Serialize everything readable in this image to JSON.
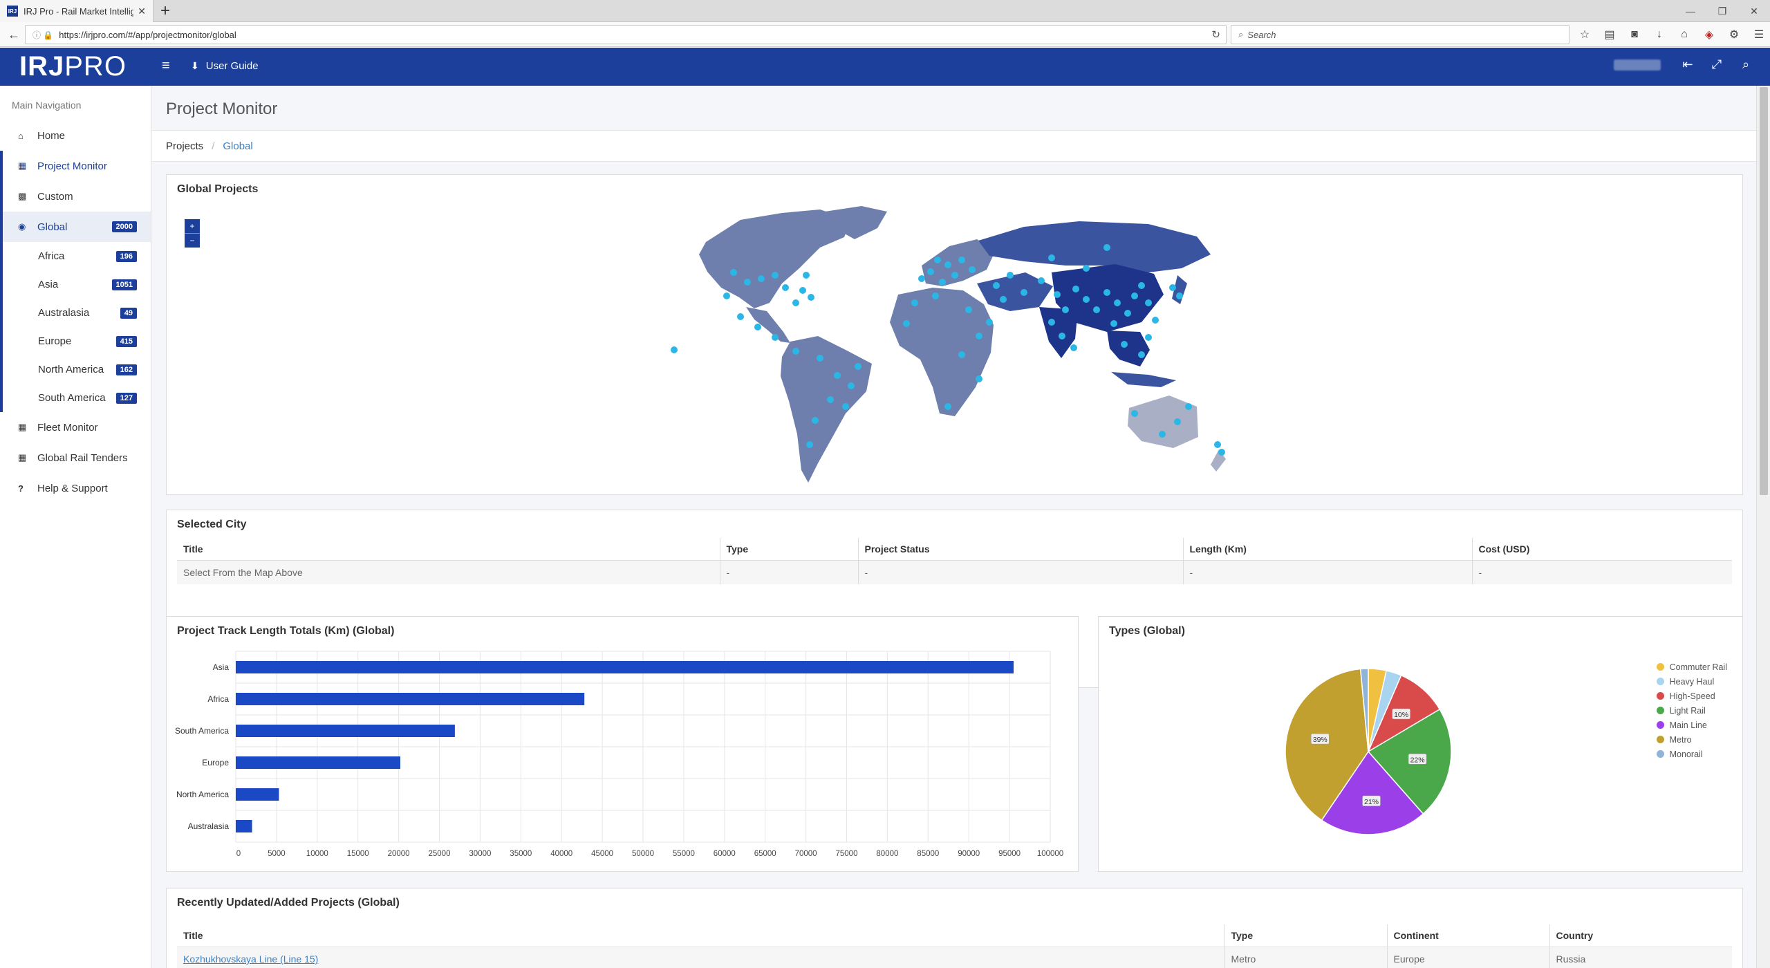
{
  "browser": {
    "tab_title": "IRJ Pro - Rail Market Intellig",
    "tab_favicon": "IRJ",
    "url": "https://irjpro.com/#/app/projectmonitor/global",
    "search_placeholder": "Search"
  },
  "header": {
    "logo_bold": "IRJ",
    "logo_light": "PRO",
    "user_guide": "User Guide",
    "color": "#1b3f9a"
  },
  "sidebar": {
    "heading": "Main Navigation",
    "home": "Home",
    "project_monitor": "Project Monitor",
    "custom": "Custom",
    "global": {
      "label": "Global",
      "count": "2000"
    },
    "regions": [
      {
        "label": "Africa",
        "count": "196"
      },
      {
        "label": "Asia",
        "count": "1051"
      },
      {
        "label": "Australasia",
        "count": "49"
      },
      {
        "label": "Europe",
        "count": "415"
      },
      {
        "label": "North America",
        "count": "162"
      },
      {
        "label": "South America",
        "count": "127"
      }
    ],
    "fleet_monitor": "Fleet Monitor",
    "tenders": "Global Rail Tenders",
    "help": "Help & Support"
  },
  "main": {
    "page_title": "Project Monitor",
    "breadcrumb": [
      "Projects",
      "Global"
    ],
    "map_title": "Global Projects",
    "zoom_in": "+",
    "zoom_out": "−",
    "selected_city": {
      "title": "Selected City",
      "columns": [
        "Title",
        "Type",
        "Project Status",
        "Length (Km)",
        "Cost (USD)"
      ],
      "row": [
        "Select From the Map Above",
        "-",
        "-",
        "-",
        "-"
      ]
    },
    "track_title": "Project Track Length Totals (Km) (Global)",
    "types_title": "Types (Global)",
    "recent": {
      "title": "Recently Updated/Added Projects (Global)",
      "columns": [
        "Title",
        "Type",
        "Continent",
        "Country"
      ],
      "row": [
        "Kozhukhovskaya Line (Line 15)",
        "Metro",
        "Europe",
        "Russia"
      ]
    }
  },
  "chart_data": [
    {
      "type": "bar",
      "orientation": "horizontal",
      "title": "Project Track Length Totals (Km) (Global)",
      "categories": [
        "Asia",
        "Africa",
        "South America",
        "Europe",
        "North America",
        "Australasia"
      ],
      "values": [
        95500,
        42800,
        26900,
        20200,
        5300,
        2000
      ],
      "xlim": [
        0,
        100000
      ],
      "xticks": [
        "0",
        "5000",
        "10000",
        "15000",
        "20000",
        "25000",
        "30000",
        "35000",
        "40000",
        "45000",
        "50000",
        "55000",
        "60000",
        "65000",
        "70000",
        "75000",
        "80000",
        "85000",
        "90000",
        "95000",
        "100000"
      ],
      "color": "#1b48c4",
      "grid": true
    },
    {
      "type": "pie",
      "title": "Types (Global)",
      "labels": [
        "Commuter Rail",
        "Heavy Haul",
        "High-Speed",
        "Light Rail",
        "Main Line",
        "Metro",
        "Monorail"
      ],
      "values": [
        3.5,
        3,
        10,
        22,
        21,
        39,
        1.5
      ],
      "data_labels": [
        "",
        "",
        "10%",
        "22%",
        "21%",
        "39%",
        ""
      ],
      "colors": [
        "#f0c040",
        "#a8d4f0",
        "#d94a4a",
        "#4aa84a",
        "#9b40e8",
        "#c2a030",
        "#8fb4d8"
      ],
      "legend": "right"
    }
  ]
}
